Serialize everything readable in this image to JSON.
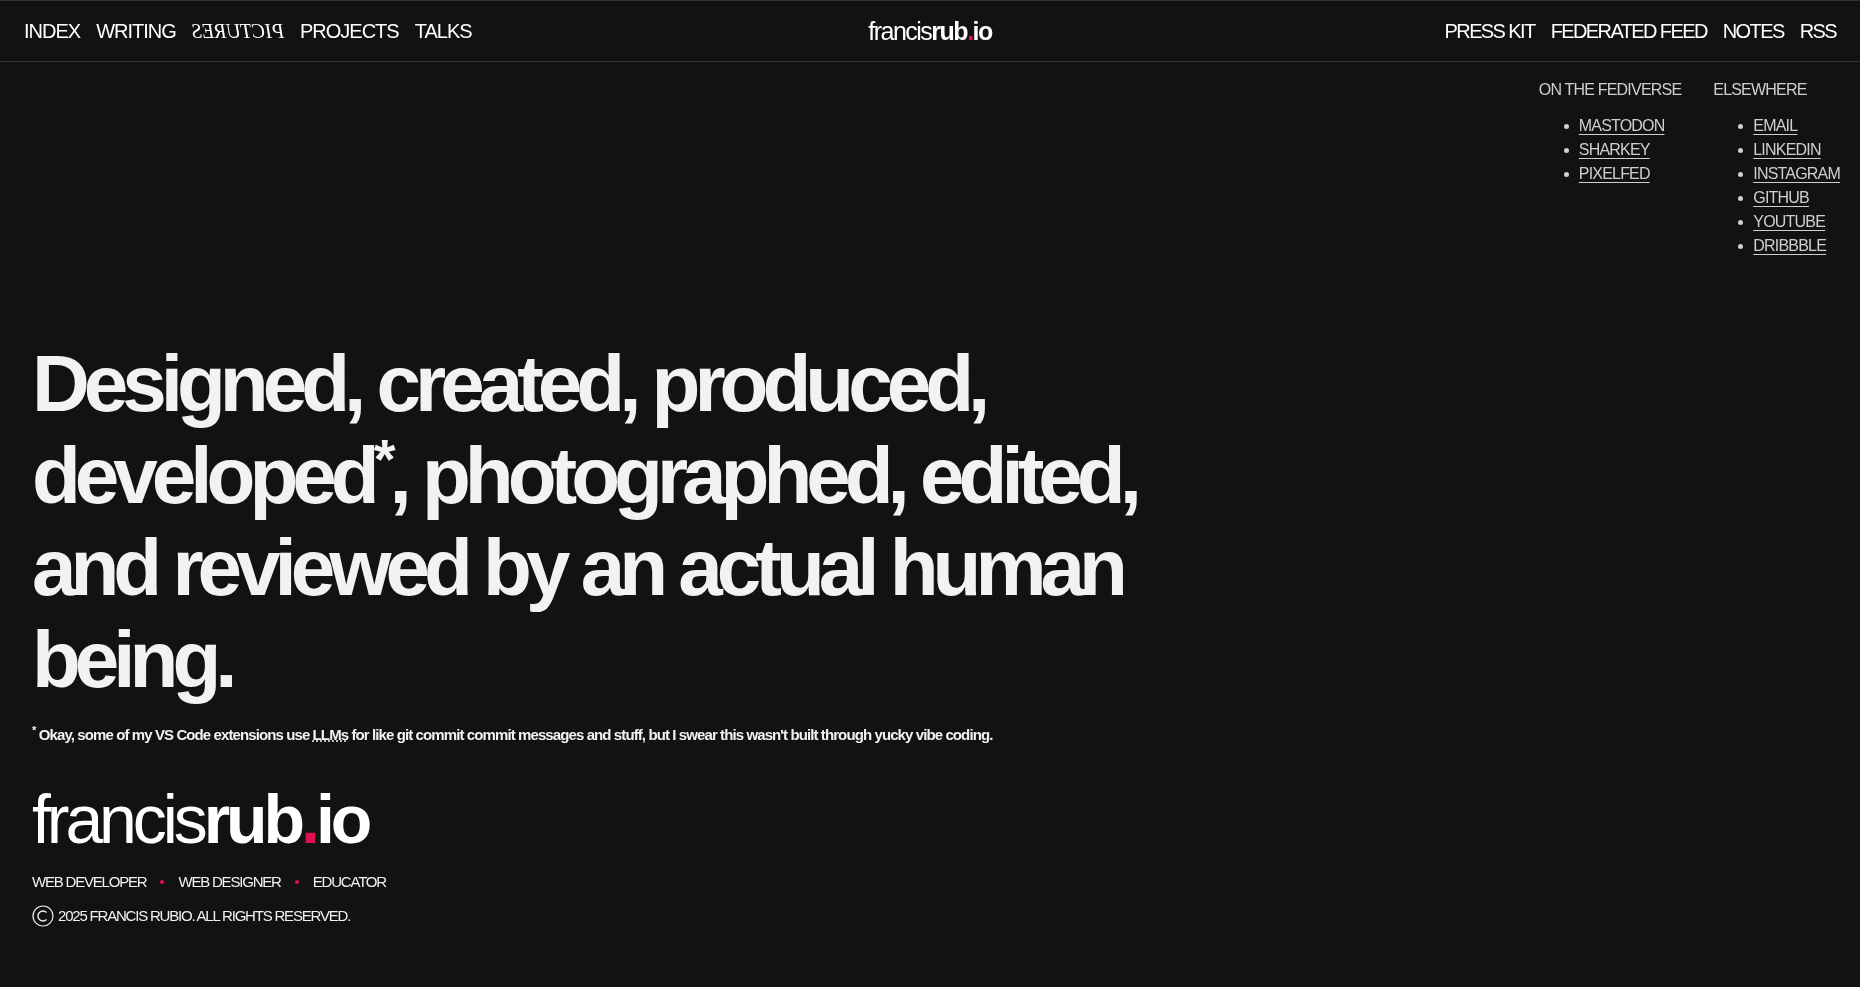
{
  "nav_left": [
    {
      "label": "INDEX",
      "kind": "plain"
    },
    {
      "label": "WRITING",
      "kind": "plain"
    },
    {
      "label": "PICTURES",
      "kind": "mirrored"
    },
    {
      "label": "PROJECTS",
      "kind": "plain"
    },
    {
      "label": "TALKS",
      "kind": "plain"
    }
  ],
  "header_logo": {
    "light": "francis",
    "bold": "rub",
    "dot": ".",
    "tld": "io"
  },
  "nav_right": [
    {
      "label": "PRESS KIT"
    },
    {
      "label": "FEDERATED FEED"
    },
    {
      "label": "NOTES"
    },
    {
      "label": "RSS"
    }
  ],
  "link_groups": [
    {
      "heading": "ON THE FEDIVERSE",
      "links": [
        "MASTODON",
        "SHARKEY",
        "PIXELFED"
      ]
    },
    {
      "heading": "ELSEWHERE",
      "links": [
        "EMAIL",
        "LINKEDIN",
        "INSTAGRAM",
        "GITHUB",
        "YOUTUBE",
        "DRIBBBLE"
      ]
    }
  ],
  "headline": [
    "Designed, created, produced,",
    "developed$^{*}$, photographed, edited,",
    "and reviewed by an actual human",
    "being."
  ],
  "footnote": {
    "marker": "*",
    "before": "Okay, some of my VS Code extensions use ",
    "link": "LLMs",
    "after": " for like git commit commit messages and stuff, but I swear this wasn't built through yucky vibe coding."
  },
  "footer_logo": {
    "light": "francis",
    "bold": "rub",
    "dot": ".",
    "tld": "io"
  },
  "roles": [
    "WEB DEVELOPER",
    "WEB DESIGNER",
    "EDUCATOR"
  ],
  "copyright": "2025 FRANCIS RUBIO. ALL RIGHTS RESERVED."
}
